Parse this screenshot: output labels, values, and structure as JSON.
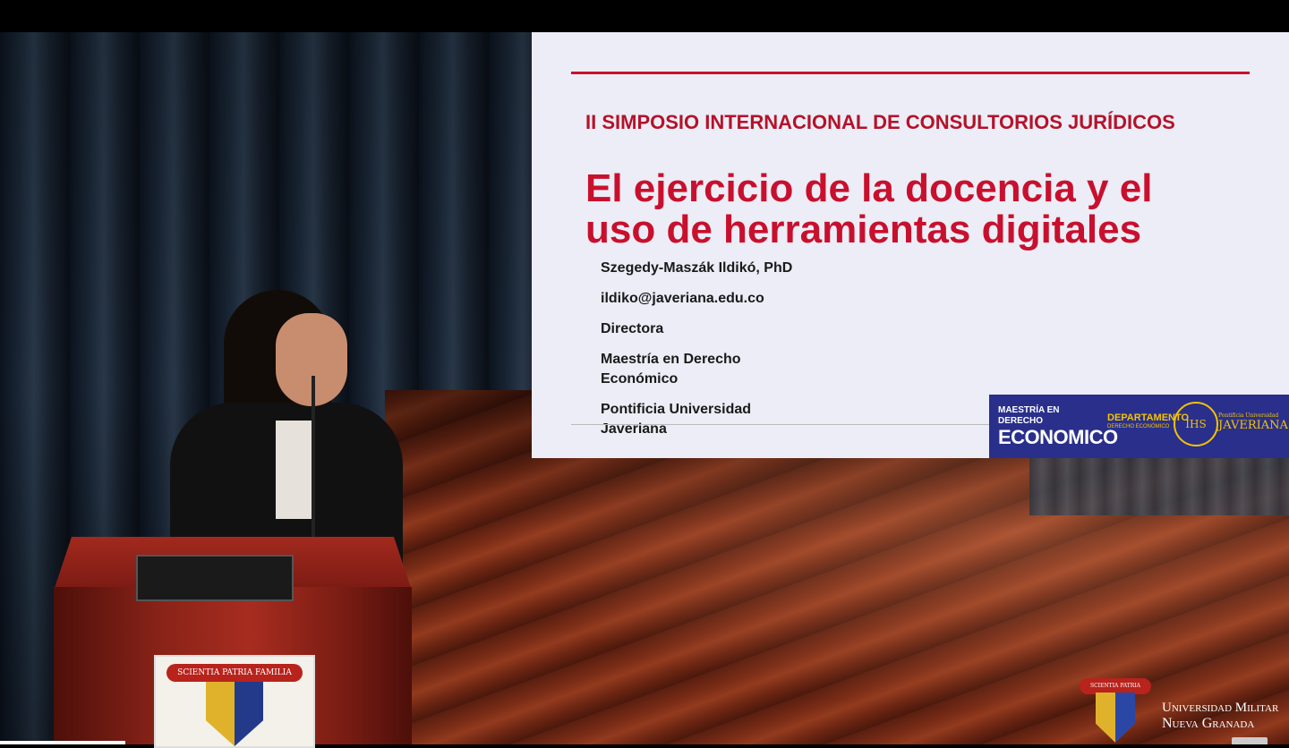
{
  "slide": {
    "event": "II SIMPOSIO INTERNACIONAL DE CONSULTORIOS JURÍDICOS",
    "title_line1": "El ejercicio de la docencia y el",
    "title_line2": "uso de herramientas digitales",
    "presenter": "Szegedy-Maszák Ildikó, PhD",
    "email": "ildiko@javeriana.edu.co",
    "role": "Directora",
    "program_line1": "Maestría en Derecho",
    "program_line2": "Económico",
    "institution_line1": "Pontificia Universidad",
    "institution_line2": "Javeriana",
    "banner": {
      "left_small": "MAESTRÍA EN DERECHO",
      "left_big": "ECONOMICO",
      "mid_big": "DEPARTAMENTO",
      "mid_small": "DERECHO ECONÓMICO",
      "seal_text": "IHS",
      "right_small": "Pontificia Universidad",
      "right_big": "JAVERIANA"
    }
  },
  "lectern": {
    "crest_ribbon": "SCIENTIA PATRIA FAMILIA"
  },
  "watermark": {
    "ribbon": "SCIENTIA PATRIA FAMILIA",
    "name_line1": "Universidad Militar",
    "name_line2": "Nueva Granada"
  },
  "colors": {
    "slide_red": "#c8102e",
    "banner_blue": "#2a2f8c",
    "banner_gold": "#f2c400"
  }
}
